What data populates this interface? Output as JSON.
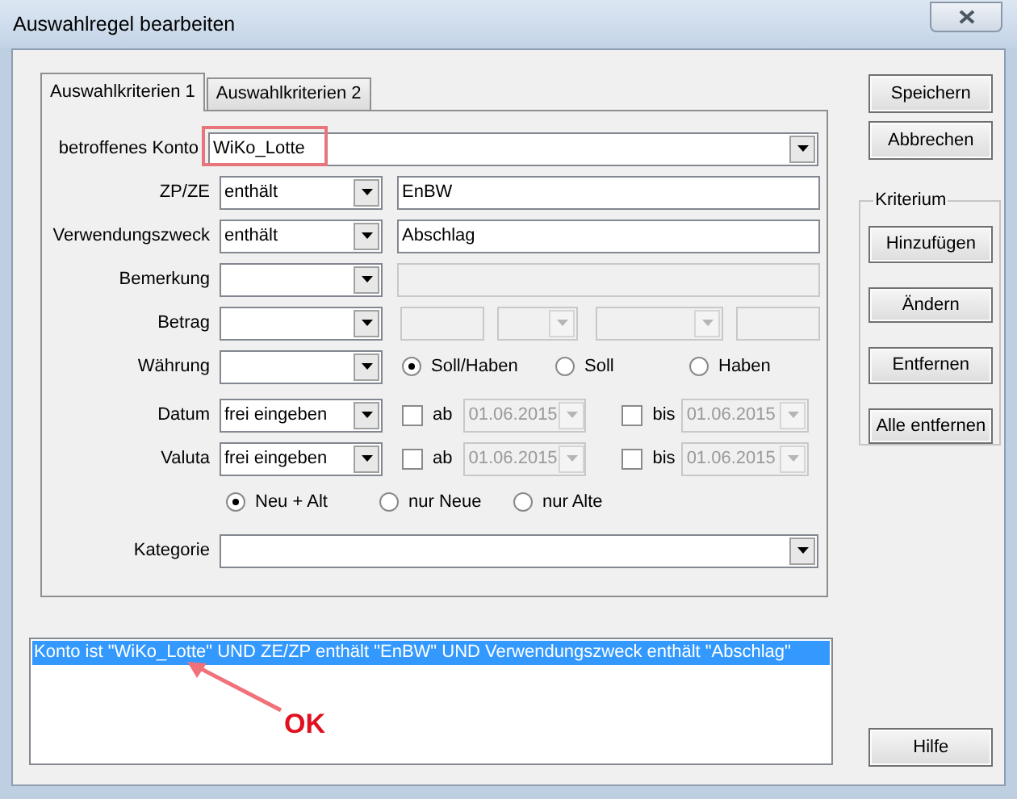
{
  "window": {
    "title": "Auswahlregel bearbeiten"
  },
  "tabs": [
    {
      "label": "Auswahlkriterien 1",
      "selected": true
    },
    {
      "label": "Auswahlkriterien 2",
      "selected": false
    }
  ],
  "konto": {
    "label": "betroffenes Konto",
    "value": "WiKo_Lotte",
    "highlighted": true
  },
  "text_rows": [
    {
      "label": "ZP/ZE",
      "operator": "enthält",
      "value": "EnBW",
      "disabled": false
    },
    {
      "label": "Verwendungszweck",
      "operator": "enthält",
      "value": "Abschlag",
      "disabled": false
    },
    {
      "label": "Bemerkung",
      "disabled": true
    }
  ],
  "betrag": {
    "label": "Betrag",
    "disabled": true
  },
  "waehrung": {
    "label": "Währung",
    "options": [
      {
        "label": "Soll/Haben",
        "selected": true
      },
      {
        "label": "Soll",
        "selected": false
      },
      {
        "label": "Haben",
        "selected": false
      }
    ]
  },
  "date_rows": [
    {
      "label": "Datum",
      "mode": "frei eingeben",
      "from": {
        "label": "ab",
        "checked": false,
        "value": "01.06.2015"
      },
      "to": {
        "label": "bis",
        "checked": false,
        "value": "01.06.2015"
      }
    },
    {
      "label": "Valuta",
      "mode": "frei eingeben",
      "from": {
        "label": "ab",
        "checked": false,
        "value": "01.06.2015"
      },
      "to": {
        "label": "bis",
        "checked": false,
        "value": "01.06.2015"
      }
    }
  ],
  "age_options": [
    {
      "label": "Neu + Alt",
      "selected": true
    },
    {
      "label": "nur Neue",
      "selected": false
    },
    {
      "label": "nur Alte",
      "selected": false
    }
  ],
  "kategorie": {
    "label": "Kategorie"
  },
  "buttons": [
    "Speichern",
    "Abbrechen"
  ],
  "kriterium": {
    "title": "Kriterium",
    "buttons": [
      "Hinzufügen",
      "Ändern",
      "Entfernen",
      "Alle entfernen"
    ]
  },
  "rules": [
    {
      "text": "Konto ist \"WiKo_Lotte\" UND ZE/ZP enthält \"EnBW\" UND Verwendungszweck enthält \"Abschlag\"",
      "selected": true
    }
  ],
  "help_button": "Hilfe",
  "annotation": {
    "text": "OK"
  }
}
